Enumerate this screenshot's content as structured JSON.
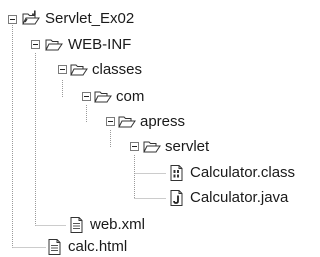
{
  "tree": {
    "root": {
      "label": "Servlet_Ex02",
      "icon": "project-folder-icon",
      "expanded": true
    },
    "web_inf": {
      "label": "WEB-INF",
      "icon": "open-folder-icon",
      "expanded": true
    },
    "classes": {
      "label": "classes",
      "icon": "open-folder-icon",
      "expanded": true
    },
    "com": {
      "label": "com",
      "icon": "open-folder-icon",
      "expanded": true
    },
    "apress": {
      "label": "apress",
      "icon": "open-folder-icon",
      "expanded": true
    },
    "servlet": {
      "label": "servlet",
      "icon": "open-folder-icon",
      "expanded": true
    },
    "calculator_class": {
      "label": "Calculator.class",
      "icon": "class-file-icon"
    },
    "calculator_java": {
      "label": "Calculator.java",
      "icon": "java-file-icon"
    },
    "web_xml": {
      "label": "web.xml",
      "icon": "text-file-icon"
    },
    "calc_html": {
      "label": "calc.html",
      "icon": "text-file-icon"
    }
  },
  "colors": {
    "guide": "#9a9a9a",
    "icon_stroke": "#333333",
    "background": "#ffffff"
  }
}
